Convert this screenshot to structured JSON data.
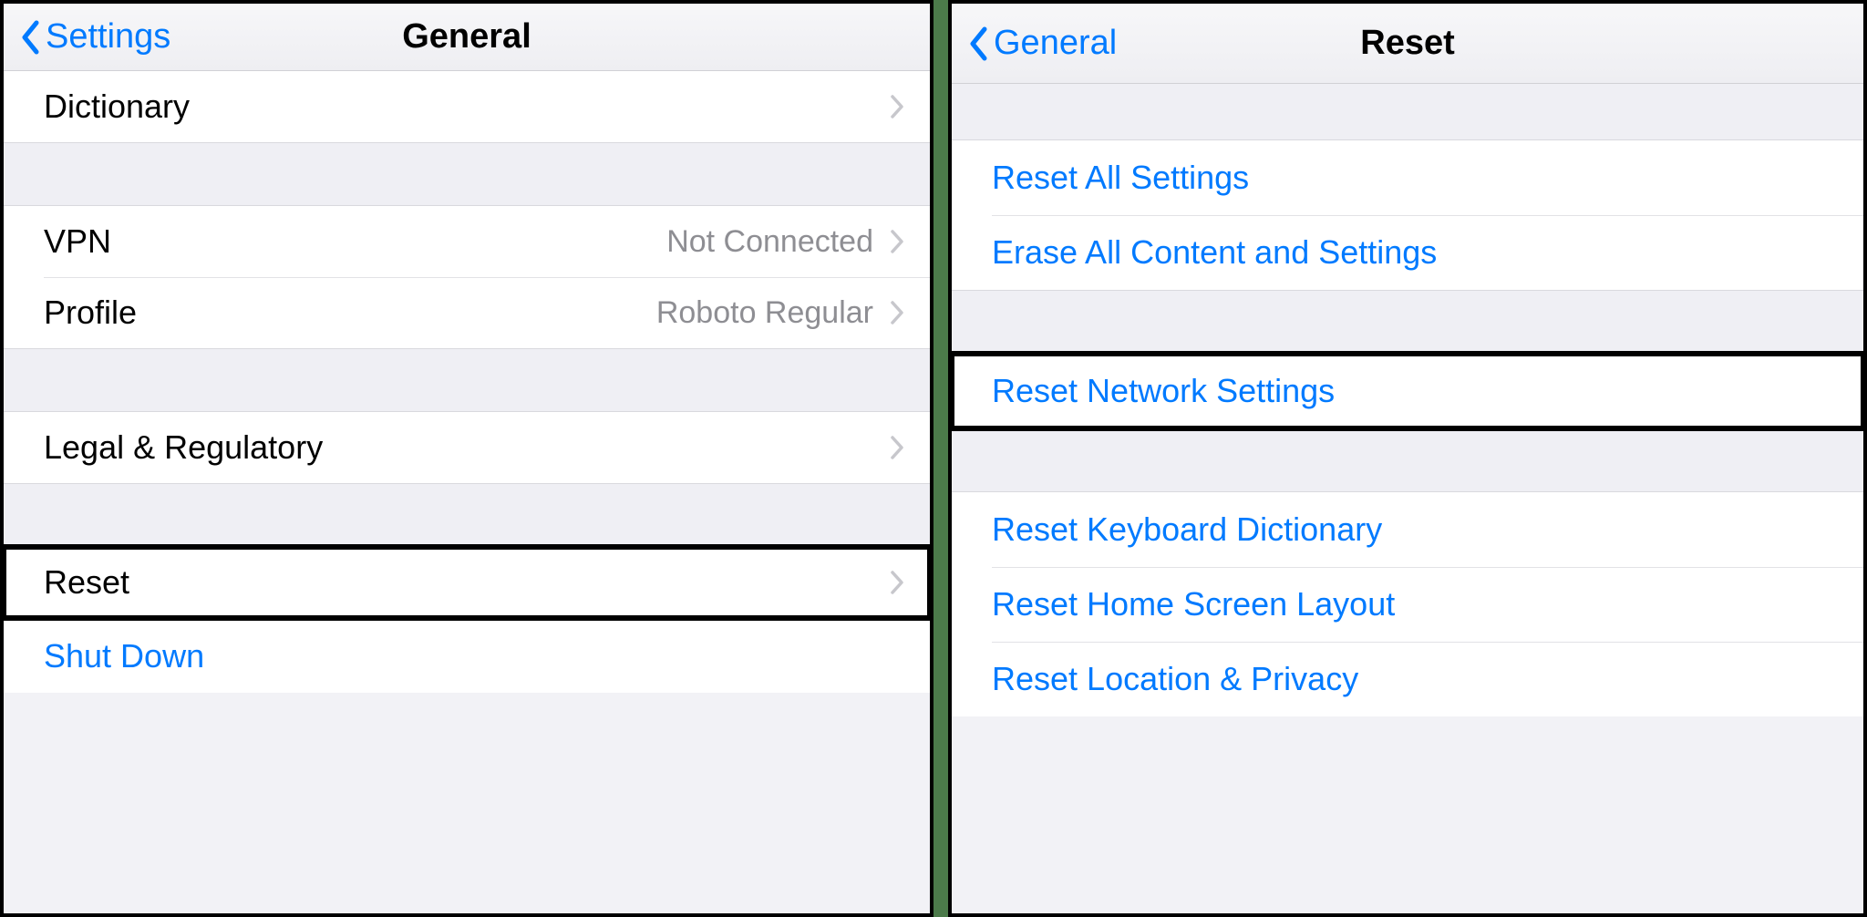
{
  "left": {
    "back_label": "Settings",
    "title": "General",
    "rows": {
      "dictionary": "Dictionary",
      "vpn": "VPN",
      "vpn_value": "Not Connected",
      "profile": "Profile",
      "profile_value": "Roboto Regular",
      "legal": "Legal & Regulatory",
      "reset": "Reset",
      "shutdown": "Shut Down"
    }
  },
  "right": {
    "back_label": "General",
    "title": "Reset",
    "rows": {
      "reset_all": "Reset All Settings",
      "erase_all": "Erase All Content and Settings",
      "reset_network": "Reset Network Settings",
      "reset_keyboard": "Reset Keyboard Dictionary",
      "reset_home": "Reset Home Screen Layout",
      "reset_location": "Reset Location & Privacy"
    }
  },
  "colors": {
    "tint": "#007aff",
    "secondary": "#8e8e93",
    "bg": "#efeff4"
  }
}
